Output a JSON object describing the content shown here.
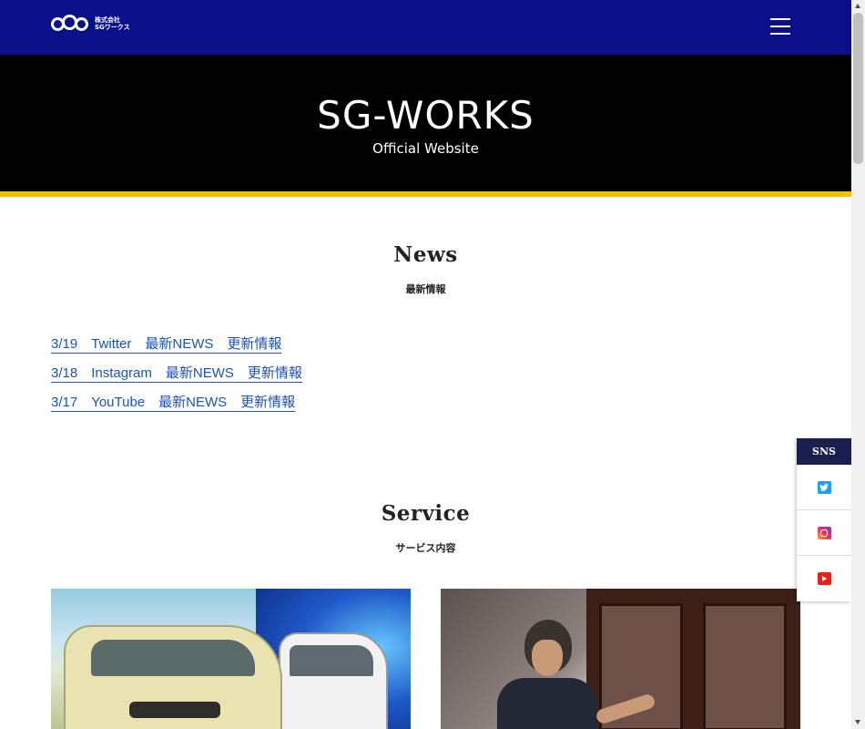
{
  "header": {
    "logo_text_line1": "株式会社",
    "logo_text_line2": "SGワークス",
    "menu_icon": "hamburger-menu-icon"
  },
  "hero": {
    "title": "SG-WORKS",
    "subtitle": "Official Website"
  },
  "news": {
    "title": "News",
    "subtitle": "最新情報",
    "items": [
      {
        "text": "3/19　Twitter　最新NEWS　更新情報"
      },
      {
        "text": "3/18　Instagram　最新NEWS　更新情報"
      },
      {
        "text": "3/17　YouTube　最新NEWS　更新情報"
      }
    ]
  },
  "service": {
    "title": "Service",
    "subtitle": "サービス内容"
  },
  "sns": {
    "label": "SNS",
    "items": [
      {
        "icon": "twitter-icon"
      },
      {
        "icon": "instagram-icon"
      },
      {
        "icon": "youtube-icon"
      }
    ]
  },
  "colors": {
    "header_bg": "#0c0f8a",
    "hero_bg": "#000000",
    "hero_accent": "#f2c200",
    "link": "#1a52b8",
    "sns_header_bg": "#1a1f4e"
  }
}
